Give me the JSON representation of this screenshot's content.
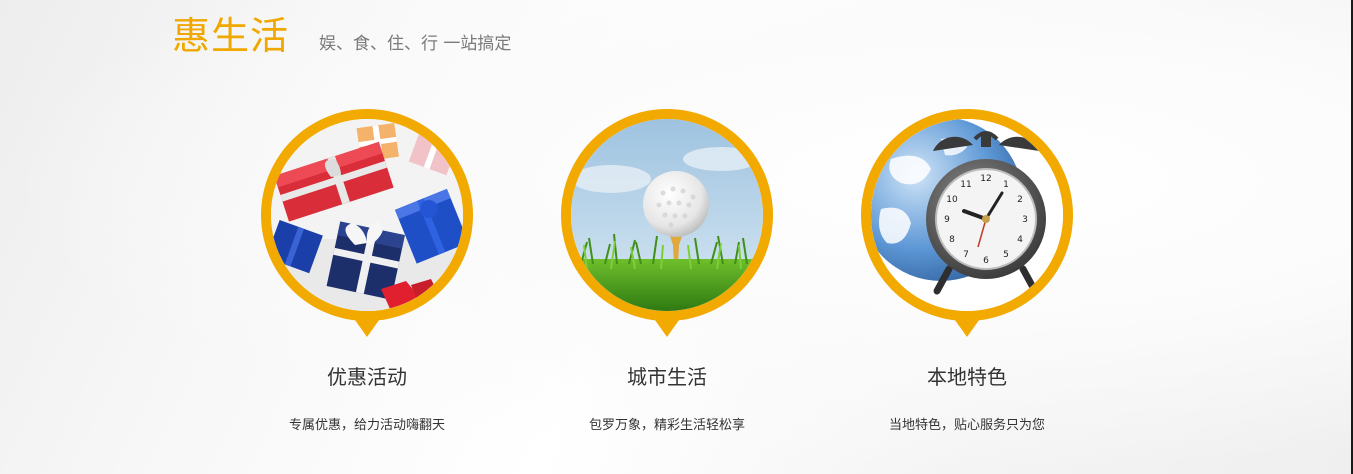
{
  "header": {
    "title": "惠生活",
    "subtitle": "娱、食、住、行 一站搞定"
  },
  "colors": {
    "accent": "#f2a900",
    "title": "#f0a800",
    "text": "#333333",
    "subtext": "#7a7a7a"
  },
  "features": [
    {
      "icon": "gift-boxes-image",
      "title": "优惠活动",
      "description": "专属优惠，给力活动嗨翻天"
    },
    {
      "icon": "golf-ball-image",
      "title": "城市生活",
      "description": "包罗万象，精彩生活轻松享"
    },
    {
      "icon": "globe-alarm-clock-image",
      "title": "本地特色",
      "description": "当地特色，贴心服务只为您"
    }
  ]
}
